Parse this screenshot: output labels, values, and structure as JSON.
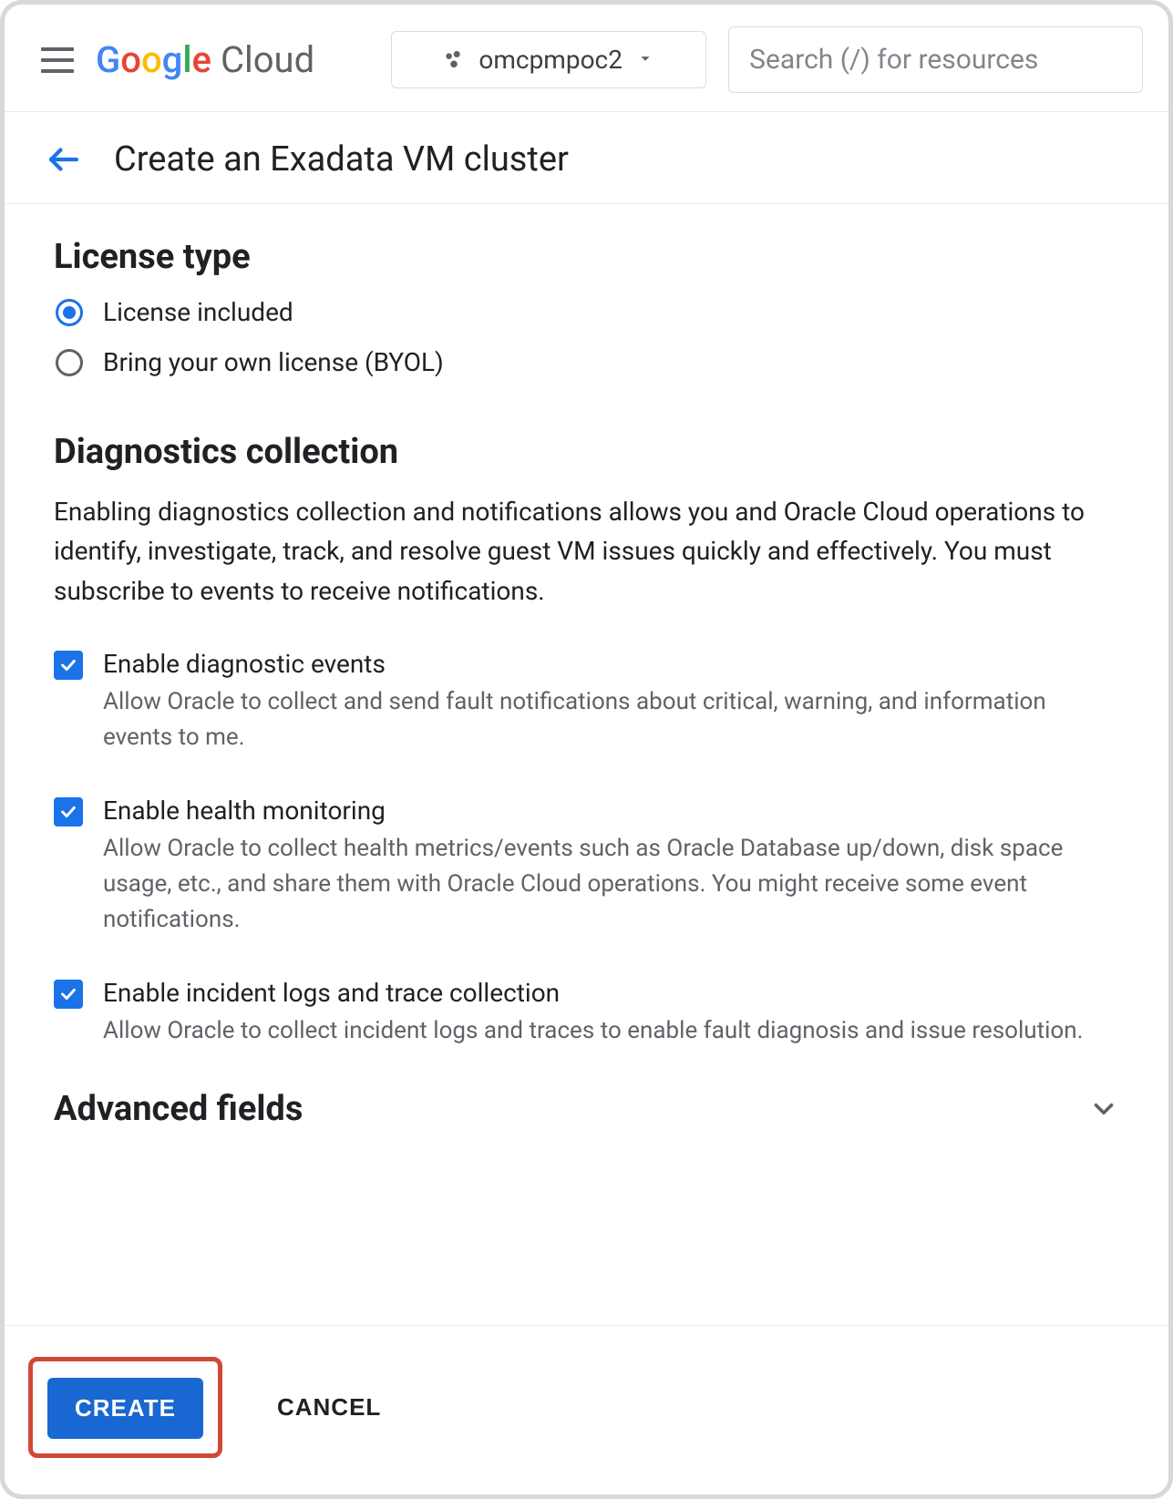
{
  "header": {
    "logo_google": "Google",
    "logo_cloud": "Cloud",
    "project_name": "omcpmpoc2",
    "search_placeholder": "Search (/) for resources"
  },
  "title": {
    "page_title": "Create an Exadata VM cluster"
  },
  "license": {
    "heading": "License type",
    "options": {
      "included": "License included",
      "byol": "Bring your own license (BYOL)"
    },
    "selected": "included"
  },
  "diagnostics": {
    "heading": "Diagnostics collection",
    "description": "Enabling diagnostics collection and notifications allows you and Oracle Cloud operations to identify, investigate, track, and resolve guest VM issues quickly and effectively. You must subscribe to events to receive notifications.",
    "items": [
      {
        "checked": true,
        "label": "Enable diagnostic events",
        "sub": "Allow Oracle to collect and send fault notifications about critical, warning, and information events to me."
      },
      {
        "checked": true,
        "label": "Enable health monitoring",
        "sub": "Allow Oracle to collect health metrics/events such as Oracle Database up/down, disk space usage, etc., and share them with Oracle Cloud operations. You might receive some event notifications."
      },
      {
        "checked": true,
        "label": "Enable incident logs and trace collection",
        "sub": "Allow Oracle to collect incident logs and traces to enable fault diagnosis and issue resolution."
      }
    ]
  },
  "advanced": {
    "heading": "Advanced fields"
  },
  "footer": {
    "create": "CREATE",
    "cancel": "CANCEL"
  }
}
